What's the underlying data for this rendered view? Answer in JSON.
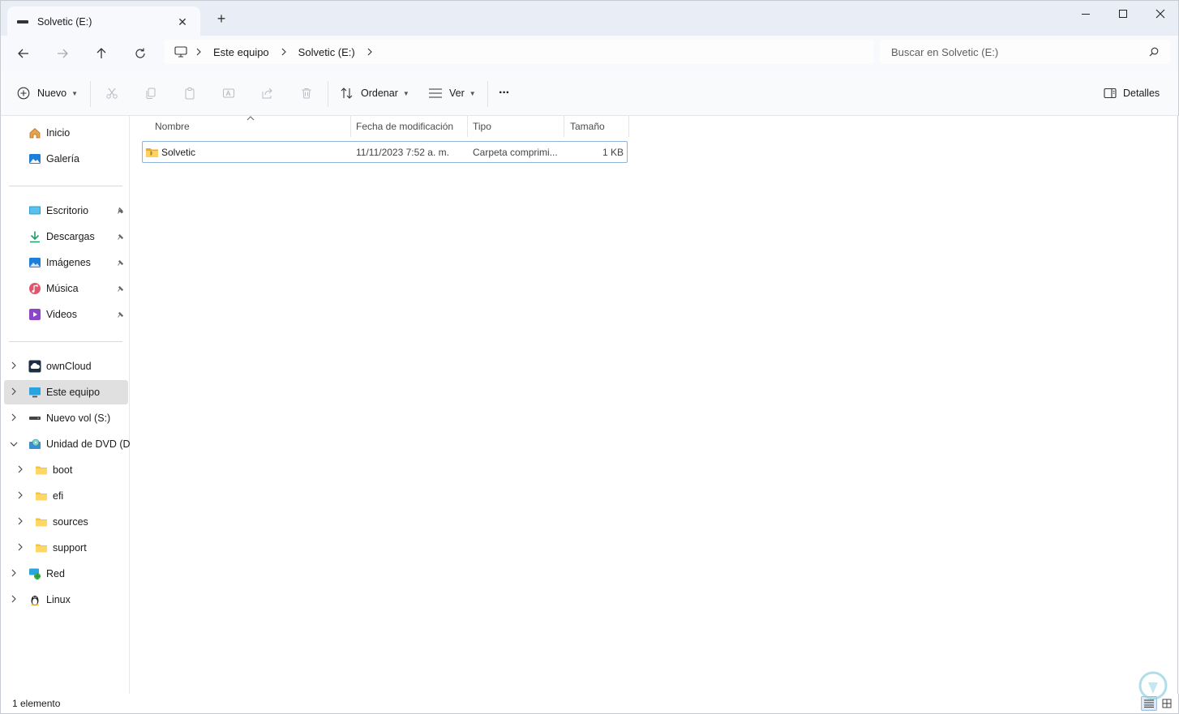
{
  "window": {
    "tab_title": "Solvetic (E:)",
    "new_tab": "+"
  },
  "address": {
    "crumbs": [
      "Este equipo",
      "Solvetic (E:)"
    ],
    "search_placeholder": "Buscar en Solvetic (E:)"
  },
  "toolbar": {
    "new_label": "Nuevo",
    "sort_label": "Ordenar",
    "view_label": "Ver",
    "more_label": "···",
    "details_label": "Detalles"
  },
  "sidebar": {
    "quick": [
      {
        "label": "Inicio",
        "icon": "home-icon"
      },
      {
        "label": "Galería",
        "icon": "gallery-icon"
      }
    ],
    "pinned": [
      {
        "label": "Escritorio",
        "icon": "desktop-icon"
      },
      {
        "label": "Descargas",
        "icon": "downloads-icon"
      },
      {
        "label": "Imágenes",
        "icon": "pictures-icon"
      },
      {
        "label": "Música",
        "icon": "music-icon"
      },
      {
        "label": "Videos",
        "icon": "videos-icon"
      }
    ],
    "tree": [
      {
        "label": "ownCloud",
        "icon": "cloud-icon",
        "expanded": false,
        "selected": false
      },
      {
        "label": "Este equipo",
        "icon": "pc-icon",
        "expanded": false,
        "selected": true
      },
      {
        "label": "Nuevo vol (S:)",
        "icon": "drive-icon",
        "expanded": false,
        "selected": false
      },
      {
        "label": "Unidad de DVD (D:)",
        "icon": "dvd-icon",
        "expanded": true,
        "selected": false
      },
      {
        "label": "boot",
        "icon": "folder-icon",
        "expanded": false,
        "selected": false
      },
      {
        "label": "efi",
        "icon": "folder-icon",
        "expanded": false,
        "selected": false
      },
      {
        "label": "sources",
        "icon": "folder-icon",
        "expanded": false,
        "selected": false
      },
      {
        "label": "support",
        "icon": "folder-icon",
        "expanded": false,
        "selected": false
      },
      {
        "label": "Red",
        "icon": "network-icon",
        "expanded": false,
        "selected": false
      },
      {
        "label": "Linux",
        "icon": "linux-icon",
        "expanded": false,
        "selected": false
      }
    ]
  },
  "table": {
    "columns": [
      "Nombre",
      "Fecha de modificación",
      "Tipo",
      "Tamaño"
    ],
    "rows": [
      {
        "name": "Solvetic",
        "date": "11/11/2023 7:52 a. m.",
        "type": "Carpeta comprimi...",
        "size": "1 KB"
      }
    ]
  },
  "status": {
    "count": "1 elemento"
  },
  "colors": {
    "accent": "#0067c0",
    "folder": "#f5c244",
    "selection": "#e0e0e0"
  }
}
